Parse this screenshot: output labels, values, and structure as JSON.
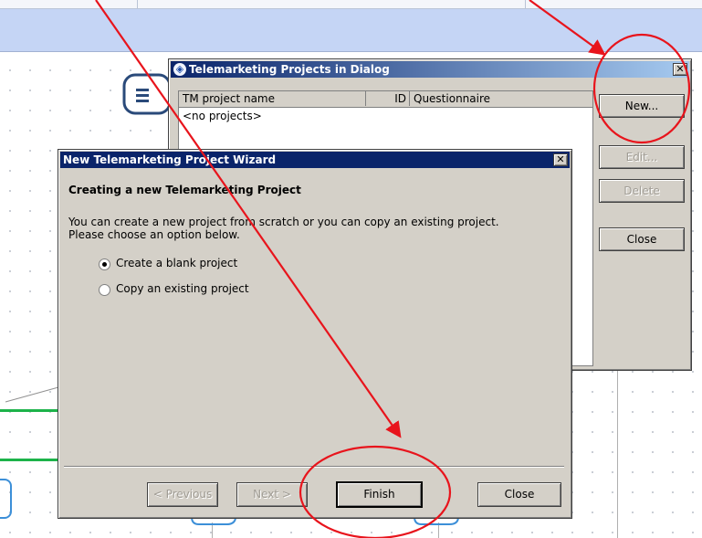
{
  "projects_dialog": {
    "title": "Telemarketing Projects in Dialog",
    "columns": [
      "TM project name",
      "ID",
      "Questionnaire"
    ],
    "empty_text": "<no projects>",
    "buttons": {
      "new": "New...",
      "edit": "Edit...",
      "delete": "Delete",
      "close": "Close"
    }
  },
  "wizard": {
    "title": "New Telemarketing Project Wizard",
    "heading": "Creating a new Telemarketing Project",
    "description_line1": "You can create a new project from scratch or you can copy an existing project.",
    "description_line2": "Please choose an option below.",
    "options": [
      {
        "label": "Create a blank project",
        "selected": true
      },
      {
        "label": "Copy an existing project",
        "selected": false
      }
    ],
    "buttons": {
      "previous": "< Previous",
      "next": "Next >",
      "finish": "Finish",
      "close": "Close"
    }
  },
  "annotation_color": "#e8141c",
  "title_bar_color": "#0a246a",
  "accent_green": "#1db34a"
}
